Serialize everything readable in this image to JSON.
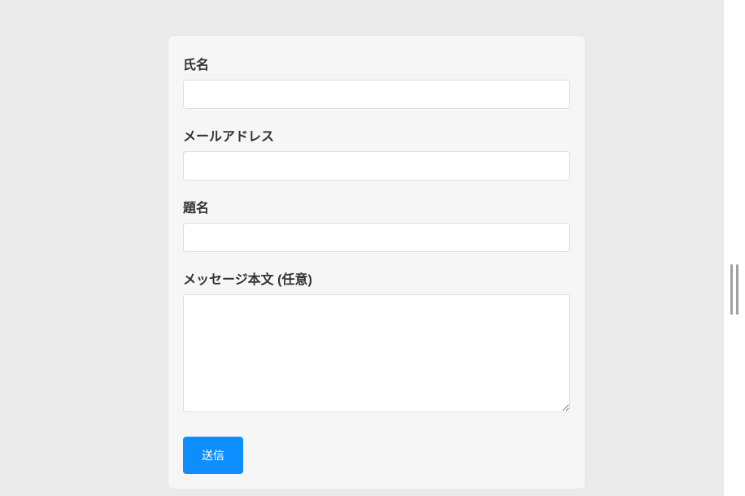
{
  "form": {
    "name": {
      "label": "氏名",
      "value": ""
    },
    "email": {
      "label": "メールアドレス",
      "value": ""
    },
    "subject": {
      "label": "題名",
      "value": ""
    },
    "message": {
      "label": "メッセージ本文 (任意)",
      "value": ""
    },
    "submit_label": "送信"
  }
}
